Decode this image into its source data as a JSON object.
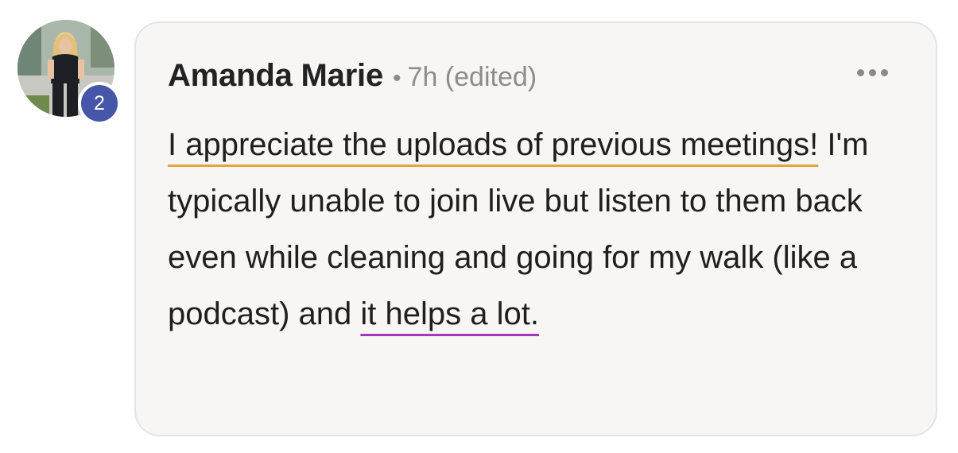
{
  "comment": {
    "author": "Amanda Marie",
    "separator": "•",
    "meta": "7h (edited)",
    "badge_count": "2",
    "text_parts": [
      "I appreciate the uploads of previous meetings!",
      " I'm typically unable to join live but listen to them back even while cleaning and going for my walk (like a podcast) and ",
      "it helps a lot."
    ]
  },
  "colors": {
    "badge": "#4656a8",
    "highlight_orange": "#e9a23b",
    "highlight_purple": "#a23ab7",
    "bubble_bg": "#f7f6f5"
  },
  "icons": {
    "more": "more-horizontal-icon",
    "avatar": "user-avatar"
  }
}
